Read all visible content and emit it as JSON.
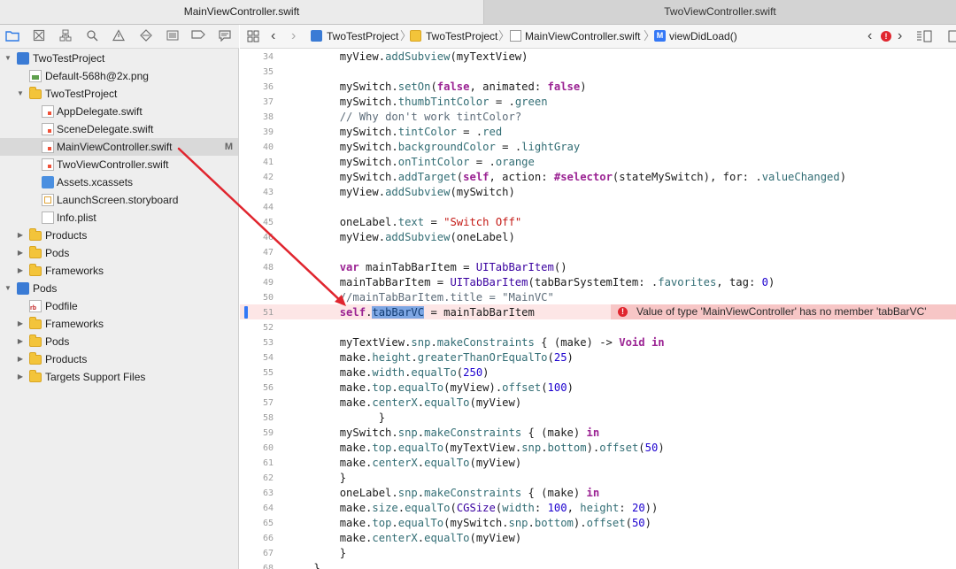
{
  "tabs": [
    {
      "label": "MainViewController.swift",
      "active": true
    },
    {
      "label": "TwoViewController.swift",
      "active": false
    }
  ],
  "navigator_icons": [
    "folder-icon",
    "source-control-icon",
    "hierarchy-icon",
    "search-icon",
    "warning-icon",
    "test-icon",
    "debug-icon",
    "breakpoint-icon",
    "report-icon"
  ],
  "sidebar": {
    "items": [
      {
        "label": "TwoTestProject",
        "kind": "project",
        "depth": 0,
        "expanded": true
      },
      {
        "label": "Default-568h@2x.png",
        "kind": "png",
        "depth": 2
      },
      {
        "label": "TwoTestProject",
        "kind": "folder",
        "depth": 1,
        "expanded": true
      },
      {
        "label": "AppDelegate.swift",
        "kind": "swift",
        "depth": 2
      },
      {
        "label": "SceneDelegate.swift",
        "kind": "swift",
        "depth": 2
      },
      {
        "label": "MainViewController.swift",
        "kind": "swift",
        "depth": 2,
        "selected": true,
        "badge": "M"
      },
      {
        "label": "TwoViewController.swift",
        "kind": "swift",
        "depth": 2
      },
      {
        "label": "Assets.xcassets",
        "kind": "xcassets",
        "depth": 2
      },
      {
        "label": "LaunchScreen.storyboard",
        "kind": "storyboard",
        "depth": 2
      },
      {
        "label": "Info.plist",
        "kind": "plist",
        "depth": 2
      },
      {
        "label": "Products",
        "kind": "folder",
        "depth": 1,
        "expanded": false
      },
      {
        "label": "Pods",
        "kind": "folder",
        "depth": 1,
        "expanded": false
      },
      {
        "label": "Frameworks",
        "kind": "folder",
        "depth": 1,
        "expanded": false
      },
      {
        "label": "Pods",
        "kind": "project",
        "depth": 0,
        "expanded": true
      },
      {
        "label": "Podfile",
        "kind": "rb",
        "depth": 2
      },
      {
        "label": "Frameworks",
        "kind": "folder",
        "depth": 1,
        "expanded": false
      },
      {
        "label": "Pods",
        "kind": "folder",
        "depth": 1,
        "expanded": false
      },
      {
        "label": "Products",
        "kind": "folder",
        "depth": 1,
        "expanded": false
      },
      {
        "label": "Targets Support Files",
        "kind": "folder",
        "depth": 1,
        "expanded": false
      }
    ]
  },
  "jumpbar": {
    "crumbs": [
      "TwoTestProject",
      "TwoTestProject",
      "MainViewController.swift",
      "viewDidLoad()"
    ],
    "method_badge": "M"
  },
  "editor": {
    "selected_word": "tabBarVC",
    "error": {
      "line": 51,
      "message": "Value of type 'MainViewController' has no member 'tabBarVC'"
    },
    "lines": [
      {
        "n": "34",
        "t": "        myView.addSubview(myTextView)"
      },
      {
        "n": "35",
        "t": ""
      },
      {
        "n": "36",
        "t": "        mySwitch.setOn(false, animated: false)"
      },
      {
        "n": "37",
        "t": "        mySwitch.thumbTintColor = .green"
      },
      {
        "n": "38",
        "t": "        // Why don't work tintColor?"
      },
      {
        "n": "39",
        "t": "        mySwitch.tintColor = .red"
      },
      {
        "n": "40",
        "t": "        mySwitch.backgroundColor = .lightGray"
      },
      {
        "n": "41",
        "t": "        mySwitch.onTintColor = .orange"
      },
      {
        "n": "42",
        "t": "        mySwitch.addTarget(self, action: #selector(stateMySwitch), for: .valueChanged)"
      },
      {
        "n": "43",
        "t": "        myView.addSubview(mySwitch)"
      },
      {
        "n": "44",
        "t": ""
      },
      {
        "n": "45",
        "t": "        oneLabel.text = \"Switch Off\""
      },
      {
        "n": "46",
        "t": "        myView.addSubview(oneLabel)"
      },
      {
        "n": "47",
        "t": ""
      },
      {
        "n": "48",
        "t": "        var mainTabBarItem = UITabBarItem()"
      },
      {
        "n": "49",
        "t": "        mainTabBarItem = UITabBarItem(tabBarSystemItem: .favorites, tag: 0)"
      },
      {
        "n": "50",
        "t": "        //mainTabBarItem.title = \"MainVC\""
      },
      {
        "n": "51",
        "t": "        self.tabBarVC = mainTabBarItem"
      },
      {
        "n": "52",
        "t": ""
      },
      {
        "n": "53",
        "t": "        myTextView.snp.makeConstraints { (make) -> Void in"
      },
      {
        "n": "54",
        "t": "        make.height.greaterThanOrEqualTo(25)"
      },
      {
        "n": "55",
        "t": "        make.width.equalTo(250)"
      },
      {
        "n": "56",
        "t": "        make.top.equalTo(myView).offset(100)"
      },
      {
        "n": "57",
        "t": "        make.centerX.equalTo(myView)"
      },
      {
        "n": "58",
        "t": "              }"
      },
      {
        "n": "59",
        "t": "        mySwitch.snp.makeConstraints { (make) in"
      },
      {
        "n": "60",
        "t": "        make.top.equalTo(myTextView.snp.bottom).offset(50)"
      },
      {
        "n": "61",
        "t": "        make.centerX.equalTo(myView)"
      },
      {
        "n": "62",
        "t": "        }"
      },
      {
        "n": "63",
        "t": "        oneLabel.snp.makeConstraints { (make) in"
      },
      {
        "n": "64",
        "t": "        make.size.equalTo(CGSize(width: 100, height: 20))"
      },
      {
        "n": "65",
        "t": "        make.top.equalTo(mySwitch.snp.bottom).offset(50)"
      },
      {
        "n": "66",
        "t": "        make.centerX.equalTo(myView)"
      },
      {
        "n": "67",
        "t": "        }"
      },
      {
        "n": "68",
        "t": "    }"
      }
    ]
  },
  "colors": {
    "error_red": "#e0252e",
    "selection_blue": "#7ea6e3",
    "arrow_red": "#e0252e"
  }
}
